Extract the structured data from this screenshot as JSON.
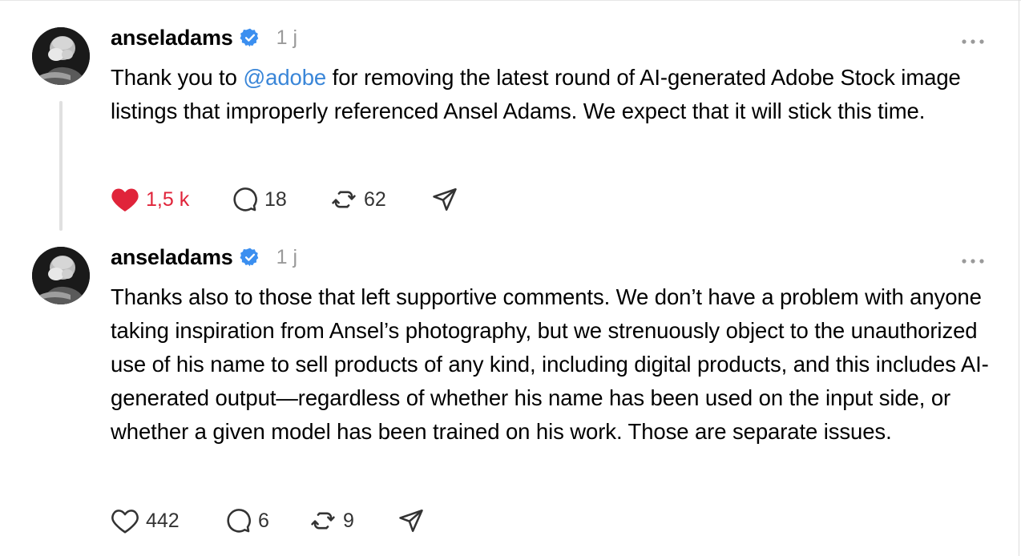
{
  "posts": [
    {
      "username": "anseladams",
      "time": "1 j",
      "text_before": "Thank you to ",
      "mention": "@adobe",
      "text_after": " for removing the latest round of AI-generated Adobe Stock image listings that improperly referenced Ansel Adams. We expect that it will stick this time.",
      "likes": "1,5 k",
      "liked": true,
      "comments": "18",
      "reposts": "62"
    },
    {
      "username": "anseladams",
      "time": "1 j",
      "text": "Thanks also to those that left supportive comments. We don’t have a problem with anyone taking inspiration from Ansel’s photography, but we strenuously object to the unauthorized use of his name to sell products of any kind, including digital products, and this includes AI-generated output—regardless of whether his name has been used on the input side, or whether a given model has been trained on his work. Those are separate issues.",
      "likes": "442",
      "liked": false,
      "comments": "6",
      "reposts": "9"
    }
  ],
  "colors": {
    "like": "#e0243a",
    "mention": "#3a86d8",
    "verified": "#3b8ff0",
    "muted": "#9a9a9a"
  },
  "icons": [
    "verified-badge-icon",
    "more-options-icon",
    "heart-icon",
    "comment-icon",
    "repost-icon",
    "share-icon"
  ]
}
